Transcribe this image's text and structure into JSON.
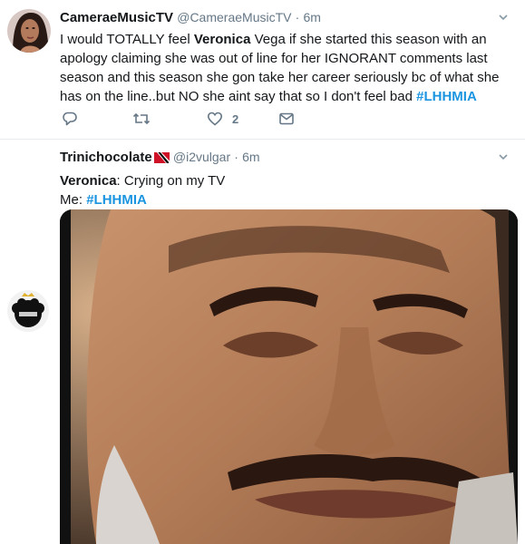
{
  "tweets": [
    {
      "display_name": "CameraeMusicTV",
      "handle": "@CameraeMusicTV",
      "separator": "·",
      "time": "6m",
      "text": {
        "part1": "I would TOTALLY feel ",
        "bold1": "Veronica",
        "part2": " Vega if she started this season with an apology claiming she was out of line for her IGNORANT comments last season and this season she gon take her career seriously bc of what she has on the line..but NO she aint say that so I don't feel bad ",
        "hashtag": "#LHHMIA"
      },
      "actions": {
        "reply_icon": "reply-icon",
        "retweet_icon": "retweet-icon",
        "like_icon": "heart-icon",
        "like_count": "2",
        "dm_icon": "envelope-icon"
      }
    },
    {
      "display_name": "Trinichocolate",
      "flag_icon": "trinidad-flag-icon",
      "handle": "@i2vulgar",
      "separator": "·",
      "time": "6m",
      "line1_bold": "Veronica",
      "line1_rest": ": Crying on my TV",
      "line2_prefix": "Me: ",
      "hashtag": "#LHHMIA",
      "media": "image of a man crying"
    }
  ],
  "colors": {
    "link": "#1b95e0",
    "muted": "#657786",
    "text": "#14171a",
    "divider": "#e6ecf0"
  }
}
